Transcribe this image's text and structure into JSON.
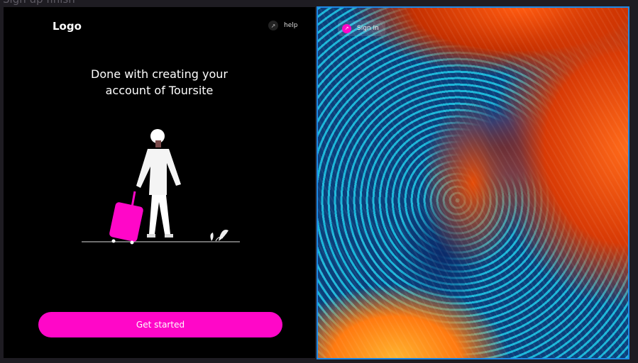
{
  "frame_title": "Sign up finish",
  "left": {
    "logo": "Logo",
    "help": {
      "icon": "arrow-up-right-icon",
      "label": "help"
    },
    "heading_line1": "Done with creating your",
    "heading_line2": "account of Toursite",
    "cta": "Get started"
  },
  "right": {
    "sign_in": {
      "icon": "arrow-up-right-icon",
      "label": "Sign In"
    }
  },
  "colors": {
    "accent": "#ff07c8",
    "selection": "#1e88e5"
  }
}
